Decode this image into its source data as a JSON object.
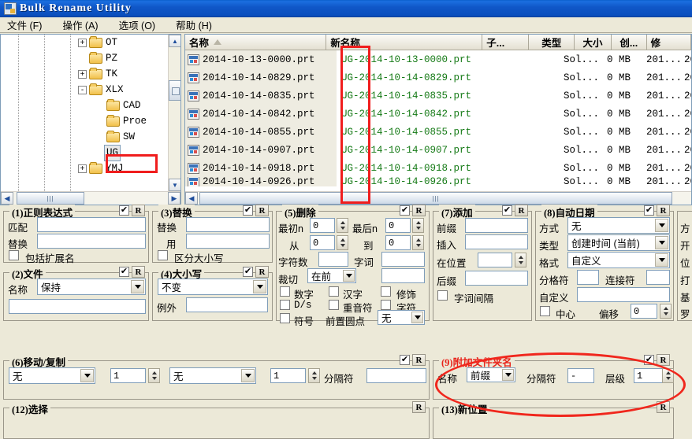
{
  "window": {
    "title": "Bulk Rename Utility",
    "icon": "app-icon"
  },
  "menu": [
    {
      "label": "文件 (F)"
    },
    {
      "label": "操作 (A)"
    },
    {
      "label": "选项 (O)"
    },
    {
      "label": "帮助 (H)"
    }
  ],
  "tree": {
    "nodes": [
      {
        "label": "OT",
        "expander": "+",
        "indent": 0,
        "selected": false
      },
      {
        "label": "PZ",
        "expander": "",
        "indent": 0,
        "selected": false
      },
      {
        "label": "TK",
        "expander": "+",
        "indent": 0,
        "selected": false
      },
      {
        "label": "XLX",
        "expander": "-",
        "indent": 0,
        "selected": false
      },
      {
        "label": "CAD",
        "expander": "",
        "indent": 1,
        "selected": false
      },
      {
        "label": "Proe",
        "expander": "",
        "indent": 1,
        "selected": false
      },
      {
        "label": "SW",
        "expander": "",
        "indent": 1,
        "selected": false
      },
      {
        "label": "UG",
        "expander": "",
        "indent": 1,
        "selected": true
      },
      {
        "label": "YMJ",
        "expander": "+",
        "indent": 0,
        "selected": false
      }
    ],
    "scroll_up_icon": "chevron-up-icon",
    "scroll_down_icon": "chevron-down-icon",
    "scroll_left_icon": "chevron-left-icon",
    "scroll_right_icon": "chevron-right-icon"
  },
  "filelist": {
    "columns": [
      {
        "label": "名称",
        "sorted": true
      },
      {
        "label": "新名称",
        "sorted": false
      },
      {
        "label": "子...",
        "sorted": false
      },
      {
        "label": "类型",
        "sorted": false
      },
      {
        "label": "大小",
        "sorted": false
      },
      {
        "label": "创...",
        "sorted": false
      },
      {
        "label": "修",
        "sorted": false
      }
    ],
    "rows": [
      {
        "name": "2014-10-13-0000.prt",
        "newname": "UG-2014-10-13-0000.prt",
        "sub": "",
        "type": "Sol...",
        "size": "0 MB",
        "created": "201...",
        "modified": "20"
      },
      {
        "name": "2014-10-14-0829.prt",
        "newname": "UG-2014-10-14-0829.prt",
        "sub": "",
        "type": "Sol...",
        "size": "0 MB",
        "created": "201...",
        "modified": "20"
      },
      {
        "name": "2014-10-14-0835.prt",
        "newname": "UG-2014-10-14-0835.prt",
        "sub": "",
        "type": "Sol...",
        "size": "0 MB",
        "created": "201...",
        "modified": "20"
      },
      {
        "name": "2014-10-14-0842.prt",
        "newname": "UG-2014-10-14-0842.prt",
        "sub": "",
        "type": "Sol...",
        "size": "0 MB",
        "created": "201...",
        "modified": "20"
      },
      {
        "name": "2014-10-14-0855.prt",
        "newname": "UG-2014-10-14-0855.prt",
        "sub": "",
        "type": "Sol...",
        "size": "0 MB",
        "created": "201...",
        "modified": "20"
      },
      {
        "name": "2014-10-14-0907.prt",
        "newname": "UG-2014-10-14-0907.prt",
        "sub": "",
        "type": "Sol...",
        "size": "0 MB",
        "created": "201...",
        "modified": "20"
      },
      {
        "name": "2014-10-14-0918.prt",
        "newname": "UG-2014-10-14-0918.prt",
        "sub": "",
        "type": "Sol...",
        "size": "0 MB",
        "created": "201...",
        "modified": "20"
      },
      {
        "name": "2014-10-14-0926.prt",
        "newname": "UG-2014-10-14-0926.prt",
        "sub": "",
        "type": "Sol...",
        "size": "0 MB",
        "created": "201...",
        "modified": "20"
      }
    ]
  },
  "panels": {
    "regex": {
      "title": "(1)正则表达式",
      "checked": true,
      "reset": "R",
      "match_label": "匹配",
      "match_value": "",
      "replace_label": "替换",
      "replace_value": "",
      "include_ext_label": "包括扩展名",
      "include_ext_checked": false
    },
    "name": {
      "title": "(2)文件",
      "checked": true,
      "reset": "R",
      "name_label": "名称",
      "mode": "保持",
      "value": ""
    },
    "replace": {
      "title": "(3)替换",
      "checked": true,
      "reset": "R",
      "replace_label": "替换",
      "replace_value": "",
      "with_label": "用",
      "with_value": "",
      "case_label": "区分大小写",
      "case_checked": false
    },
    "case": {
      "title": "(4)大小写",
      "checked": true,
      "reset": "R",
      "mode": "不变",
      "except_label": "例外",
      "except_value": ""
    },
    "remove": {
      "title": "(5)删除",
      "checked": true,
      "reset": "R",
      "first_n_label": "最初n",
      "first_n": "0",
      "last_n_label": "最后n",
      "last_n": "0",
      "from_label": "从",
      "from": "0",
      "to_label": "到",
      "to": "0",
      "chars_label": "字符数",
      "chars": "",
      "words_label": "字词",
      "words": "",
      "crop_label": "裁切",
      "crop_mode": "在前",
      "crop_value": "",
      "digits_label": "数字",
      "digits_checked": false,
      "hanzi_label": "汉字",
      "hanzi_checked": false,
      "decor_label": "修饰",
      "decor_checked": false,
      "ds_label": "D/s",
      "ds_checked": false,
      "accents_label": "重音符",
      "accents_checked": false,
      "chars2_label": "字符",
      "chars2_checked": false,
      "symbols_label": "符号",
      "symbols_checked": false,
      "lead_dots_label": "前置圆点",
      "lead_dots": "无"
    },
    "move": {
      "title": "(6)移动/复制",
      "checked": true,
      "reset": "R",
      "mode1": "无",
      "count1": "1",
      "mode2": "无",
      "count2": "1",
      "sep_label": "分隔符",
      "sep_value": ""
    },
    "add": {
      "title": "(7)添加",
      "checked": true,
      "reset": "R",
      "prefix_label": "前缀",
      "prefix_value": "",
      "insert_label": "插入",
      "insert_value": "",
      "at_pos_label": "在位置",
      "at_pos_value": "",
      "suffix_label": "后缀",
      "suffix_value": "",
      "word_space_label": "字词间隔",
      "word_space_checked": false
    },
    "autodate": {
      "title": "(8)自动日期",
      "checked": true,
      "reset": "R",
      "mode_label": "方式",
      "mode": "无",
      "type_label": "类型",
      "type": "创建时间 (当前)",
      "format_label": "格式",
      "format": "自定义",
      "sep_label": "分格符",
      "sep_value": "",
      "join_label": "连接符",
      "join_value": "",
      "custom_label": "自定义",
      "custom_value": "",
      "center_label": "中心",
      "center_checked": false,
      "offset_label": "偏移",
      "offset_value": "0"
    },
    "appendfolder": {
      "title": "(9)附加文件夹名",
      "checked": true,
      "reset": "R",
      "name_label": "名称",
      "name_mode": "前缀",
      "sep_label": "分隔符",
      "sep_value": "-",
      "level_label": "层级",
      "level_value": "1",
      "title_color": "#e8241b"
    },
    "numbering_partial": {
      "rows": [
        "方",
        "开",
        "位",
        "打",
        "基",
        "罗"
      ]
    },
    "selection": {
      "title": "(12)选择",
      "reset": "R"
    },
    "newlocation": {
      "title": "(13)新位置",
      "reset": "R"
    }
  },
  "annotations": {
    "folder_box": "red-rectangle-around-ug-folder",
    "newname_box": "red-rectangle-around-newname-prefix",
    "appendfolder_ellipse": "red-ellipse-around-panel-9"
  }
}
